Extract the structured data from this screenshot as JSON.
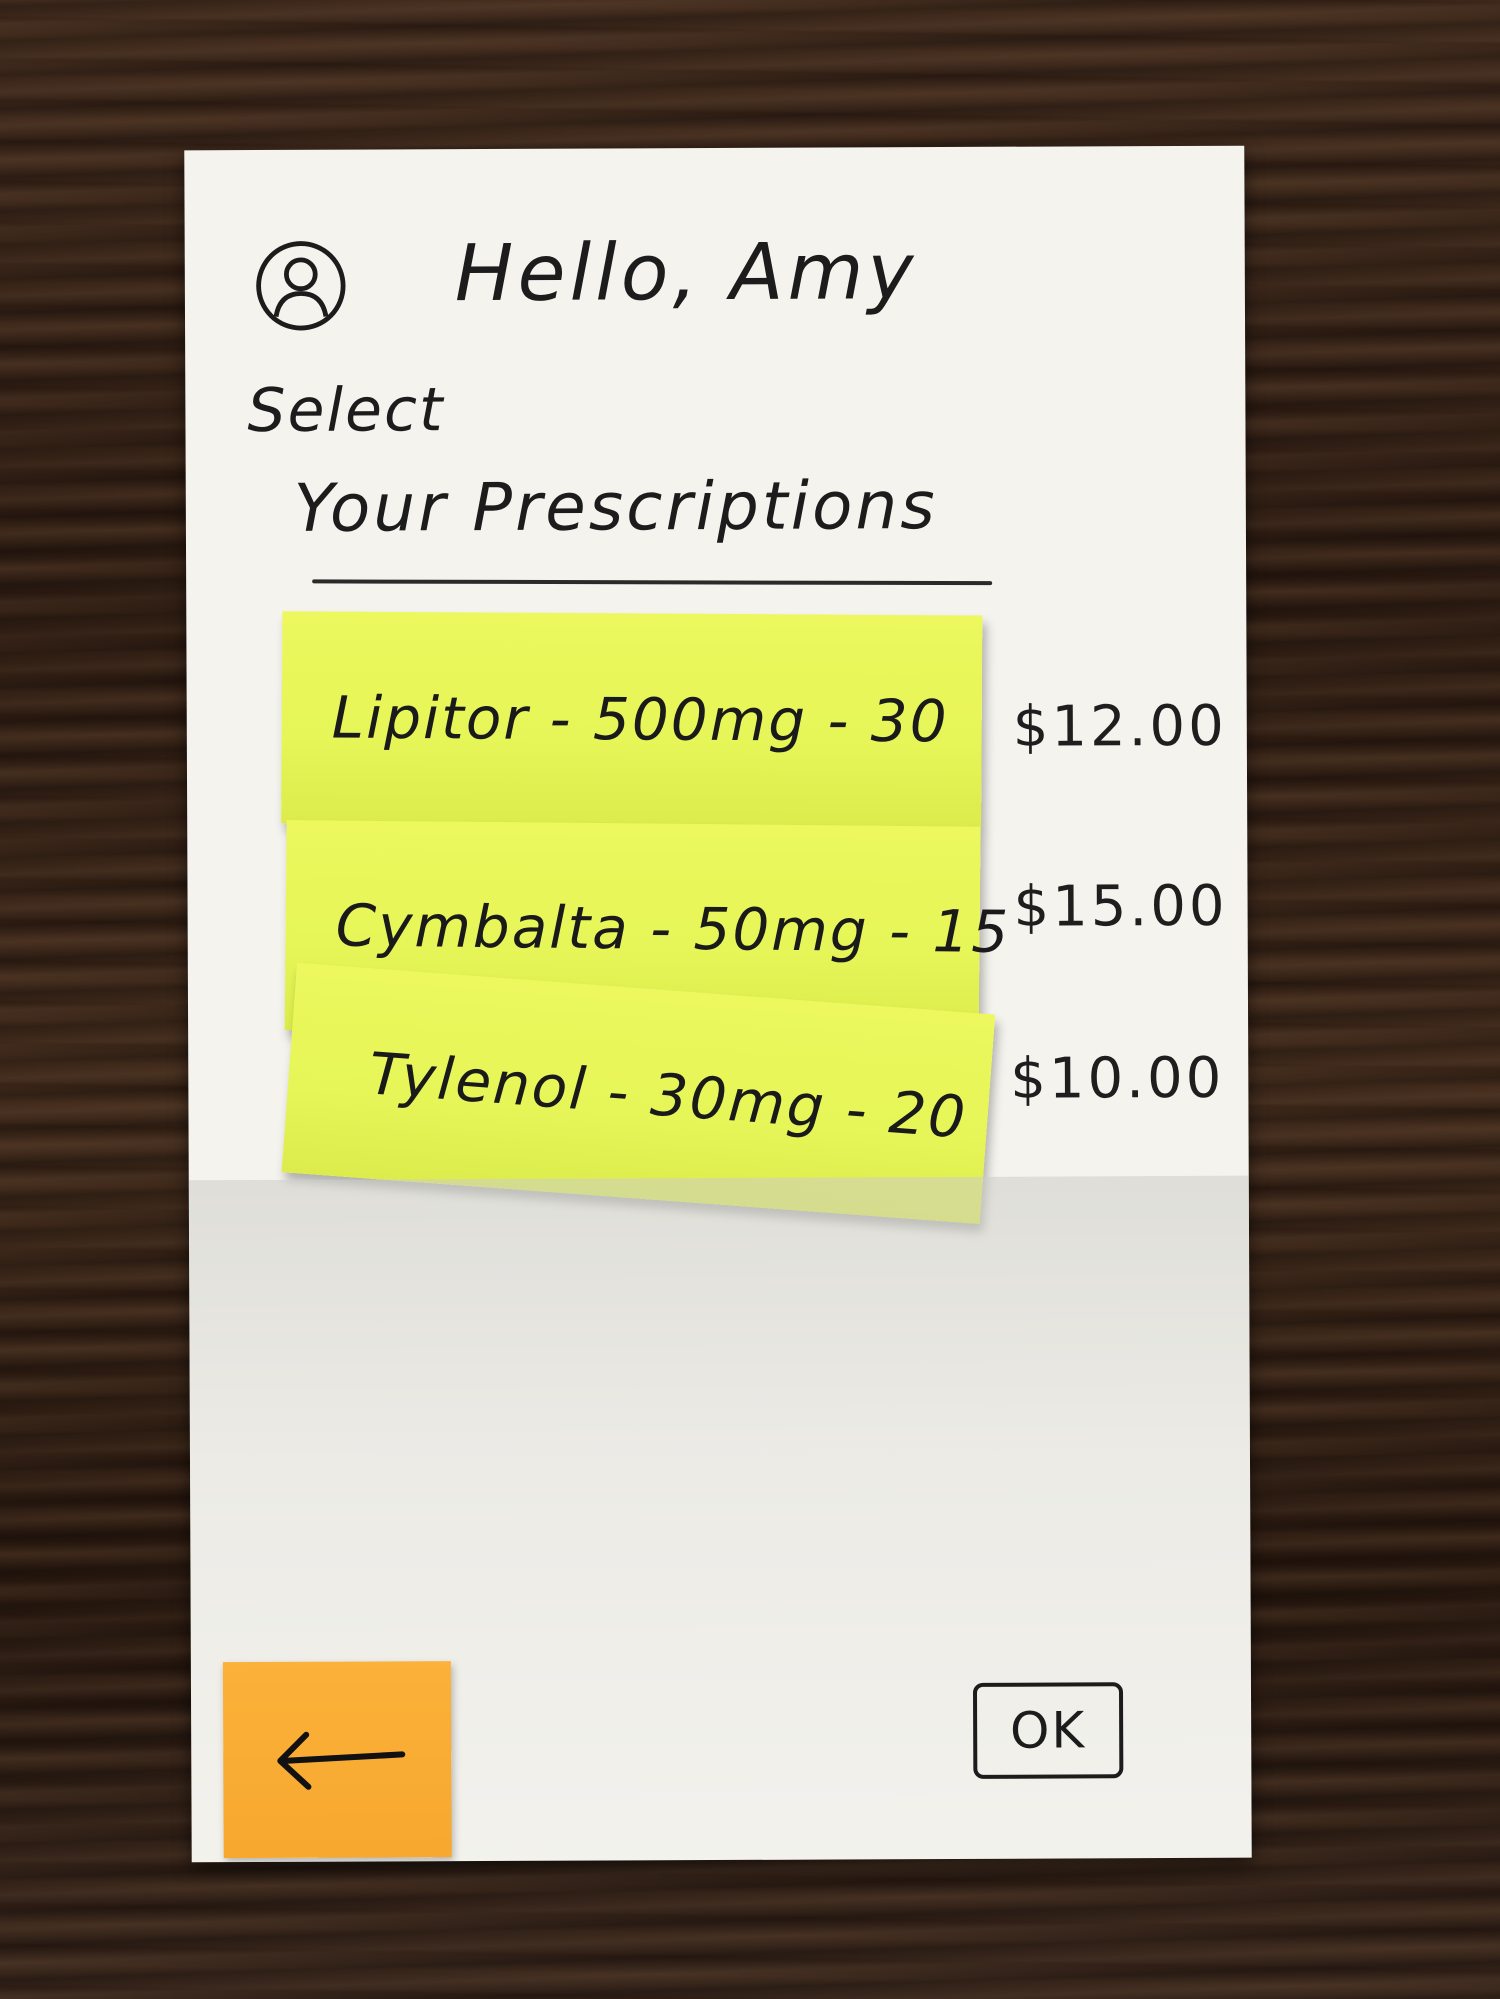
{
  "header": {
    "greeting": "Hello, Amy",
    "avatar_icon": "user-avatar-icon"
  },
  "prescriptions": {
    "select_label": "Select",
    "title": "Your Prescriptions",
    "items": [
      {
        "label": "Lipitor - 500mg - 30",
        "price": "$12.00"
      },
      {
        "label": "Cymbalta - 50mg - 15",
        "price": "$15.00"
      },
      {
        "label": "Tylenol - 30mg - 20",
        "price": "$10.00"
      }
    ]
  },
  "footer": {
    "back_icon": "arrow-left-icon",
    "ok_label": "OK"
  },
  "colors": {
    "paper": "#f4f3ee",
    "sticky_note": "#e6f557",
    "back_note": "#f7a82e",
    "ink": "#1c1c1c",
    "table_wood": "#2e1d13"
  }
}
